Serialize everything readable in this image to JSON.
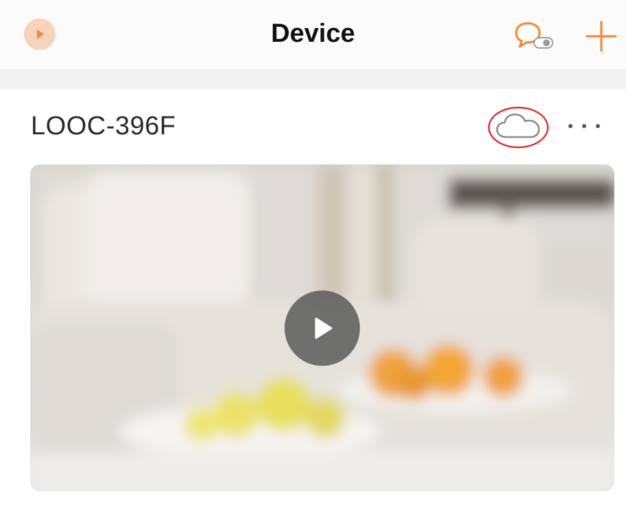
{
  "header": {
    "title": "Device",
    "left_icon": "play-circle-icon",
    "chat_icon": "chat-toggle-icon",
    "add_icon": "plus-icon"
  },
  "device": {
    "name": "LOOC-396F",
    "cloud_icon": "cloud-icon",
    "more_icon": "more-dots-icon",
    "preview_play_icon": "play-icon"
  },
  "colors": {
    "accent": "#f08a3c",
    "title_text": "#111111",
    "highlight_ring": "#e0302b",
    "cloud_stroke": "#8a8a8a"
  }
}
